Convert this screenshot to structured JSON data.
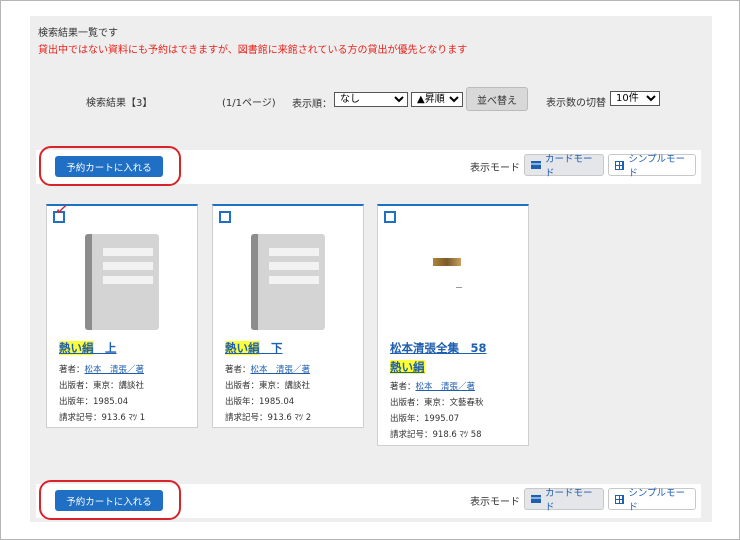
{
  "heading": "検索結果一覧です",
  "notice": "貸出中ではない資料にも予約はできますが、図書館に来館されている方の貸出が優先となります",
  "controls": {
    "result_count": "検索結果【3】",
    "page_info": "(1/1ページ)",
    "sort_label": "表示順：",
    "sort_value": "なし",
    "order_value": "▲昇順",
    "sort_button": "並べ替え",
    "per_page_label": "表示数の切替",
    "per_page_value": "10件"
  },
  "toolbar": {
    "cart_button": "予約カートに入れる",
    "mode_label": "表示モード",
    "card_mode": "カードモード",
    "simple_mode": "シンプルモード"
  },
  "books": [
    {
      "title_hl": "熱い絹",
      "title_rest": "　上",
      "author_label": "著者：",
      "author": "松本　清張／著",
      "publisher": "出版者：東京：講談社",
      "year": "出版年：1985.04",
      "call_no": "請求記号：913.6 ﾏﾂ 1",
      "checked": true
    },
    {
      "title_hl": "熱い絹",
      "title_rest": "　下",
      "author_label": "著者：",
      "author": "松本　清張／著",
      "publisher": "出版者：東京：講談社",
      "year": "出版年：1985.04",
      "call_no": "請求記号：913.6 ﾏﾂ 2",
      "checked": false
    },
    {
      "title": "松本清張全集　58",
      "subtitle_hl": "熱い絹",
      "author_label": "著者：",
      "author": "松本　清張／著",
      "publisher": "出版者：東京：文藝春秋",
      "year": "出版年：1995.07",
      "call_no": "請求記号：918.6 ﾏﾂ 58",
      "checked": false
    }
  ],
  "colors": {
    "accent": "#1f6fc5",
    "notice": "#e8231c",
    "highlight": "#ffff33",
    "ring": "#d8232a"
  }
}
